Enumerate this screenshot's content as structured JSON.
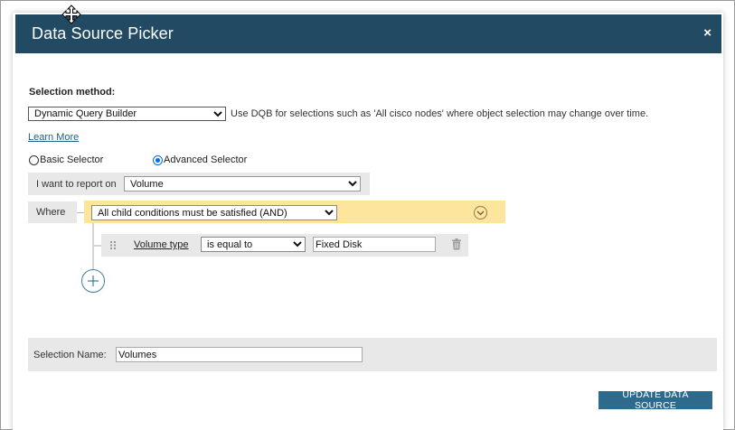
{
  "dialog": {
    "title": "Data Source Picker",
    "close_glyph": "×"
  },
  "selection_method": {
    "label": "Selection method:",
    "selected": "Dynamic Query Builder",
    "hint": "Use DQB for selections such as 'All cisco nodes' where object selection may change over time.",
    "learn_more": "Learn More"
  },
  "selector_mode": {
    "basic_label": "Basic Selector",
    "advanced_label": "Advanced Selector",
    "selected": "advanced"
  },
  "report_on": {
    "label": "I want to report on",
    "selected": "Volume"
  },
  "where": {
    "label": "Where",
    "group_operator": "All child conditions must be satisfied (AND)",
    "condition": {
      "field": "Volume type",
      "operator": "is equal to",
      "value": "Fixed Disk"
    }
  },
  "selection_name": {
    "label": "Selection Name:",
    "value": "Volumes"
  },
  "actions": {
    "update_label": "UPDATE DATA SOURCE"
  },
  "icons": {
    "close": "close-icon",
    "collapse": "chevron-down-circle-icon",
    "drag": "drag-handle-icon",
    "delete": "trash-icon",
    "add": "plus-circle-icon",
    "cursor": "move-cursor-icon"
  },
  "colors": {
    "titlebar": "#234a63",
    "and_group": "#fde59e",
    "primary_button": "#2d6a8c",
    "link": "#1f5f86"
  }
}
